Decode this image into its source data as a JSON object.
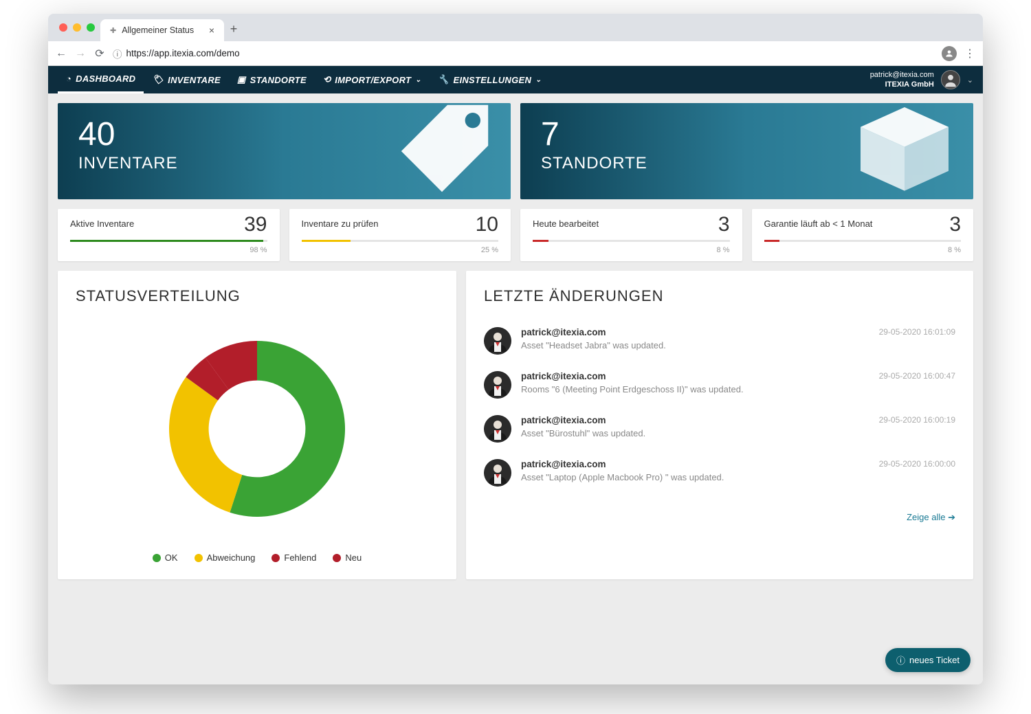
{
  "browser": {
    "tab_title": "Allgemeiner Status",
    "url": "https://app.itexia.com/demo"
  },
  "nav": {
    "items": [
      {
        "label": "DASHBOARD",
        "icon": "pie-icon",
        "active": true
      },
      {
        "label": "INVENTARE",
        "icon": "tag-icon",
        "active": false
      },
      {
        "label": "STANDORTE",
        "icon": "box-icon",
        "active": false
      },
      {
        "label": "IMPORT/EXPORT",
        "icon": "sync-icon",
        "active": false,
        "caret": true
      },
      {
        "label": "EINSTELLUNGEN",
        "icon": "wrench-icon",
        "active": false,
        "caret": true
      }
    ],
    "user_email": "patrick@itexia.com",
    "user_org": "ITEXIA GmbH"
  },
  "heroes": [
    {
      "value": "40",
      "label": "INVENTARE",
      "icon": "tag"
    },
    {
      "value": "7",
      "label": "STANDORTE",
      "icon": "box"
    }
  ],
  "stats": [
    {
      "title": "Aktive Inventare",
      "value": "39",
      "pct": "98 %",
      "pct_n": 98,
      "color": "#2e8b1f"
    },
    {
      "title": "Inventare zu prüfen",
      "value": "10",
      "pct": "25 %",
      "pct_n": 25,
      "color": "#f2c200"
    },
    {
      "title": "Heute bearbeitet",
      "value": "3",
      "pct": "8 %",
      "pct_n": 8,
      "color": "#c92a2a"
    },
    {
      "title": "Garantie läuft ab < 1 Monat",
      "value": "3",
      "pct": "8 %",
      "pct_n": 8,
      "color": "#c92a2a"
    }
  ],
  "status_panel_title": "STATUSVERTEILUNG",
  "changes_panel_title": "LETZTE ÄNDERUNGEN",
  "chart_data": {
    "type": "pie",
    "title": "STATUSVERTEILUNG",
    "series": [
      {
        "name": "OK",
        "value": 55,
        "color": "#3aa335"
      },
      {
        "name": "Abweichung",
        "value": 30,
        "color": "#f2c200"
      },
      {
        "name": "Fehlend",
        "value": 5,
        "color": "#b21e2a"
      },
      {
        "name": "Neu",
        "value": 10,
        "color": "#b21e2a"
      }
    ],
    "legend": [
      "OK",
      "Abweichung",
      "Fehlend",
      "Neu"
    ],
    "legend_colors": [
      "#3aa335",
      "#f2c200",
      "#b21e2a",
      "#b21e2a"
    ]
  },
  "changes": [
    {
      "who": "patrick@itexia.com",
      "what": "Asset \"Headset Jabra\" was updated.",
      "when": "29-05-2020 16:01:09"
    },
    {
      "who": "patrick@itexia.com",
      "what": "Rooms \"6 (Meeting Point Erdgeschoss II)\" was updated.",
      "when": "29-05-2020 16:00:47"
    },
    {
      "who": "patrick@itexia.com",
      "what": "Asset \"Bürostuhl\" was updated.",
      "when": "29-05-2020 16:00:19"
    },
    {
      "who": "patrick@itexia.com",
      "what": "Asset \"Laptop (Apple Macbook Pro) \" was updated.",
      "when": "29-05-2020 16:00:00"
    }
  ],
  "show_all_label": "Zeige alle",
  "ticket_button": "neues Ticket"
}
